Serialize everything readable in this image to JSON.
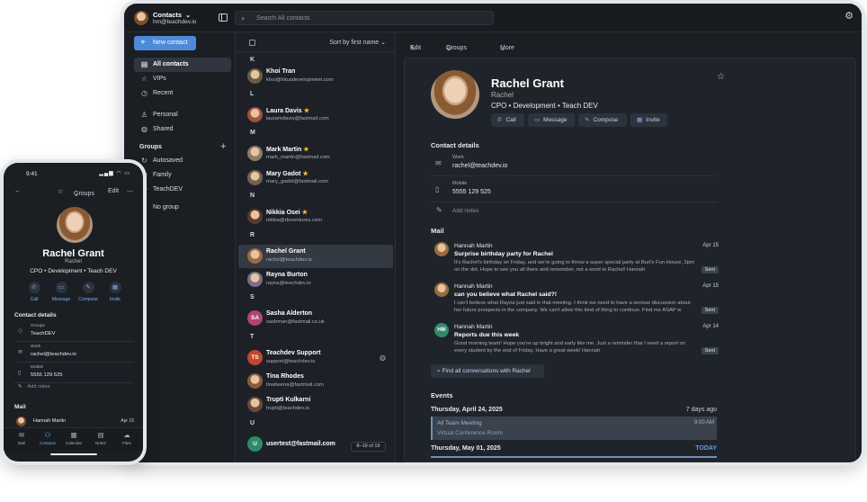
{
  "account": {
    "name": "Contacts",
    "email": "hm@teachdev.io"
  },
  "search": {
    "placeholder": "Search All contacts"
  },
  "new_contact_label": "New contact",
  "sidebar": {
    "items": [
      {
        "label": "All contacts",
        "icon": "contacts-icon",
        "selected": true
      },
      {
        "label": "VIPs",
        "icon": "star-outline-icon"
      },
      {
        "label": "Recent",
        "icon": "clock-icon"
      },
      {
        "label": "Personal",
        "icon": "person-icon"
      },
      {
        "label": "Shared",
        "icon": "globe-icon"
      }
    ],
    "groups_heading": "Groups",
    "groups": [
      {
        "label": "Autosaved",
        "icon": "refresh-icon"
      },
      {
        "label": "Family",
        "icon": "people-icon"
      },
      {
        "label": "TeachDEV",
        "icon": "people-icon"
      },
      {
        "label": "No group",
        "icon": "person-icon"
      }
    ]
  },
  "list": {
    "sort_label": "Sort by first name",
    "page_indicator": "8–19 of 19",
    "letters": [
      "K",
      "L",
      "M",
      "N",
      "R",
      "S",
      "T",
      "U"
    ],
    "contacts": [
      {
        "name": "Khoi Tran",
        "email": "khoi@lotusdevelopment.com",
        "starred": false,
        "initials": "",
        "color": "#6b5a4a"
      },
      {
        "name": "Laura Davis",
        "email": "lauramdavis@fastmail.com",
        "starred": true,
        "initials": "",
        "color": "#a0523d"
      },
      {
        "name": "Mark Martin",
        "email": "mark_martin@fastmail.com",
        "starred": true,
        "initials": "",
        "color": "#8a7a6a"
      },
      {
        "name": "Mary Gadot",
        "email": "mary_gadot@fastmail.com",
        "starred": true,
        "initials": "",
        "color": "#6f6254"
      },
      {
        "name": "Nikkia Osei",
        "email": "nikkia@doventures.com",
        "starred": true,
        "initials": "",
        "color": "#5a3a28"
      },
      {
        "name": "Rachel Grant",
        "email": "rachel@teachdev.io",
        "starred": false,
        "initials": "",
        "color": "#9a6a40",
        "selected": true
      },
      {
        "name": "Rayna Burton",
        "email": "rayna@teachdev.io",
        "starred": false,
        "initials": "",
        "color": "#7a6e8a"
      },
      {
        "name": "Sasha Alderton",
        "email": "sashman@fastmail.co.uk",
        "starred": false,
        "initials": "SA",
        "color": "#b0456e"
      },
      {
        "name": "Teachdev Support",
        "email": "support@teachdev.io",
        "starred": false,
        "initials": "TS",
        "color": "#c0472d",
        "shared": true
      },
      {
        "name": "Tina Rhodes",
        "email": "tinabeena@fastmail.com",
        "starred": false,
        "initials": "",
        "color": "#8a5a3a"
      },
      {
        "name": "Trupti Kulkarni",
        "email": "trupti@teachdev.io",
        "starred": false,
        "initials": "",
        "color": "#6a4a3a"
      },
      {
        "name": "usertest@fastmail.com",
        "email": "",
        "starred": false,
        "initials": "U",
        "color": "#2f8a6a"
      }
    ]
  },
  "toolbar": {
    "edit": "Edit",
    "groups": "Groups",
    "more": "More"
  },
  "contact": {
    "name": "Rachel Grant",
    "nickname": "Rachel",
    "role": "CPO • Development • Teach DEV",
    "actions": [
      "Call",
      "Message",
      "Compose",
      "Invite"
    ],
    "details_heading": "Contact details",
    "fields": [
      {
        "label": "Work",
        "value": "rachel@teachdev.io",
        "icon": "mail-icon"
      },
      {
        "label": "Mobile",
        "value": "5555 129 525",
        "icon": "phone-icon"
      }
    ],
    "add_notes": "Add notes",
    "mail_heading": "Mail",
    "mails": [
      {
        "from": "Hannah Martin",
        "date": "Apr 15",
        "subject": "Surprise birthday party for Rachel",
        "preview": "It's Rachel's birthday on Friday, and we're going to throw a super special party at Burt's Fun House, 2pm on the dot. Hope to see you all there and remember, not a word to Rachel! Hannah",
        "badge": "Sent",
        "initials": "",
        "color": "#9a6a40"
      },
      {
        "from": "Hannah Martin",
        "date": "Apr 15",
        "subject": "can you believe what Rachel said?!",
        "preview": "I can't believe what Rayna just said in that meeting. I think we need to have a serious discussion about her future prospects in the company. We can't allow this kind of thing to continue. Find me ASAP w",
        "badge": "Sent",
        "initials": "",
        "color": "#9a6a40"
      },
      {
        "from": "Hannah Martin",
        "date": "Apr 14",
        "subject": "Reports due this week",
        "preview": "Good morning team! Hope you're up bright and early like me. Just a reminder that I need a report on every student by the end of Friday. Have a great week! Hannah",
        "badge": "Sent",
        "initials": "HM",
        "color": "#2f8a6a"
      }
    ],
    "find_all_label": "Find all conversations with Rachel",
    "events_heading": "Events",
    "events": [
      {
        "date": "Thursday, April 24, 2025",
        "relative": "7 days ago",
        "title": "All Team Meeting",
        "room": "Virtual Conference Room",
        "time": "9:00 AM"
      },
      {
        "date": "Thursday, May 01, 2025",
        "relative": "TODAY"
      }
    ]
  },
  "phone": {
    "time": "9:41",
    "groups": "Groups",
    "edit": "Edit",
    "name": "Rachel Grant",
    "nickname": "Rachel",
    "role": "CPO • Development • Teach DEV",
    "actions": [
      "Call",
      "Message",
      "Compose",
      "Invite"
    ],
    "details_heading": "Contact details",
    "fields": [
      {
        "label": "Groups",
        "value": "TeachDEV"
      },
      {
        "label": "Work",
        "value": "rachel@teachdev.io"
      },
      {
        "label": "Mobile",
        "value": "5555 129 525"
      }
    ],
    "add_notes": "Add notes",
    "mail_heading": "Mail",
    "mail_from": "Hannah Martin",
    "mail_date": "Apr 15",
    "tabs": [
      "Mail",
      "Contacts",
      "Calendar",
      "Notes",
      "Files"
    ]
  }
}
